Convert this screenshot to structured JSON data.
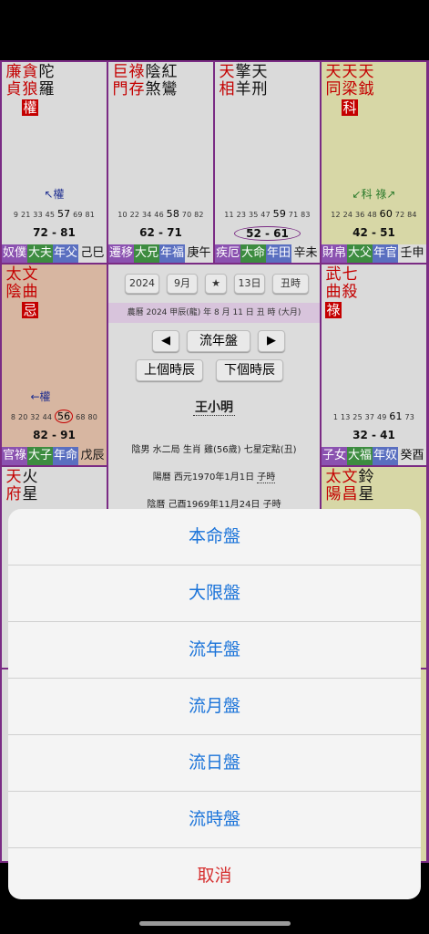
{
  "cells": {
    "tl": {
      "cols": [
        {
          "r": "廉",
          "k": null,
          "a": "貞"
        },
        {
          "r": "貪",
          "a": "狼",
          "hua": "權"
        },
        {
          "k": "陀",
          "k2": "羅"
        }
      ],
      "marker": "↖權",
      "ages": [
        "9",
        "21",
        "33",
        "45",
        "57",
        "69",
        "81"
      ],
      "age_hl": "57",
      "range": "72 - 81",
      "footer": [
        "奴僕",
        "大夫",
        "年父",
        "己巳"
      ]
    },
    "tm1": {
      "cols": [
        {
          "r": "巨",
          "a": "門"
        },
        {
          "r": "祿",
          "a": "存"
        },
        {
          "k": "陰",
          "k2": "煞"
        },
        {
          "k": "紅",
          "k2": "鸞"
        }
      ],
      "marker": "",
      "ages": [
        "10",
        "22",
        "34",
        "46",
        "58",
        "70",
        "82"
      ],
      "age_hl": "58",
      "range": "62 - 71",
      "footer": [
        "遷移",
        "大兄",
        "年福",
        "庚午"
      ]
    },
    "tm2": {
      "cols": [
        {
          "r": "天",
          "a": "相"
        },
        {
          "k": "擎",
          "k2": "羊"
        },
        {
          "k": "天",
          "k2": "刑"
        }
      ],
      "marker": "",
      "ages": [
        "11",
        "23",
        "35",
        "47",
        "59",
        "71",
        "83"
      ],
      "age_hl": "59",
      "range": "52 - 61",
      "footer": [
        "疾厄",
        "大命",
        "年田",
        "辛未"
      ]
    },
    "tr": {
      "cols": [
        {
          "r": "天",
          "a": "同"
        },
        {
          "r": "天",
          "a": "梁",
          "hua": "科"
        },
        {
          "r": "天",
          "a": "鉞"
        }
      ],
      "marker": "↙科 祿↗",
      "ages": [
        "12",
        "24",
        "36",
        "48",
        "60",
        "72",
        "84"
      ],
      "age_hl": "60",
      "range": "42 - 51",
      "footer": [
        "財帛",
        "大父",
        "年官",
        "壬申"
      ]
    },
    "ml": {
      "cols": [
        {
          "r": "太",
          "a": "陰"
        },
        {
          "r": "文",
          "a": "曲",
          "hua": "忌"
        }
      ],
      "marker": "←權",
      "ages": [
        "8",
        "20",
        "32",
        "44",
        "56",
        "68",
        "80"
      ],
      "age_hl": "56",
      "range": "82 - 91",
      "footer": [
        "官祿",
        "大子",
        "年命",
        "戊辰"
      ]
    },
    "mr": {
      "cols": [
        {
          "r": "武",
          "a": "曲",
          "hua": "祿"
        },
        {
          "r": "七",
          "a": "殺"
        }
      ],
      "marker": "",
      "ages": [
        "1",
        "13",
        "25",
        "37",
        "49",
        "61",
        "73"
      ],
      "age_hl": "61",
      "range": "32 - 41",
      "footer": [
        "子女",
        "大福",
        "年奴",
        "癸酉"
      ]
    },
    "bl": {
      "cols": [
        {
          "r": "天",
          "a": "府"
        },
        {
          "k": "火",
          "k2": "星"
        }
      ]
    },
    "br": {
      "cols": [
        {
          "r": "太",
          "a": "陽"
        },
        {
          "r": "文",
          "a": "昌"
        },
        {
          "k": "鈴",
          "k2": "星"
        }
      ]
    }
  },
  "center": {
    "year": "2024",
    "month": "9月",
    "star": "★",
    "day": "13日",
    "hour": "丑時",
    "lunar": "農曆 2024 甲辰(龍) 年 8 月 11 日 丑 時 (大月)",
    "prev_arrow": "◀",
    "mode": "流年盤",
    "next_arrow": "▶",
    "prev_hour": "上個時辰",
    "next_hour": "下個時辰",
    "name": "王小明",
    "line1": "陰男 水二局 生肖 雞(56歲) 七星定點(丑)",
    "line2_prefix": "陽曆 西元1970年1月1日 ",
    "line2_hour": "子時",
    "line3": "陰曆 己酉1969年11月24日 子時"
  },
  "sheet": {
    "options": [
      "本命盤",
      "大限盤",
      "流年盤",
      "流月盤",
      "流日盤",
      "流時盤"
    ],
    "cancel": "取消"
  },
  "colors": {
    "chart_border": "#7a2b84",
    "red_star": "#c40000",
    "option_blue": "#1a73d9",
    "cancel_red": "#d63030"
  }
}
